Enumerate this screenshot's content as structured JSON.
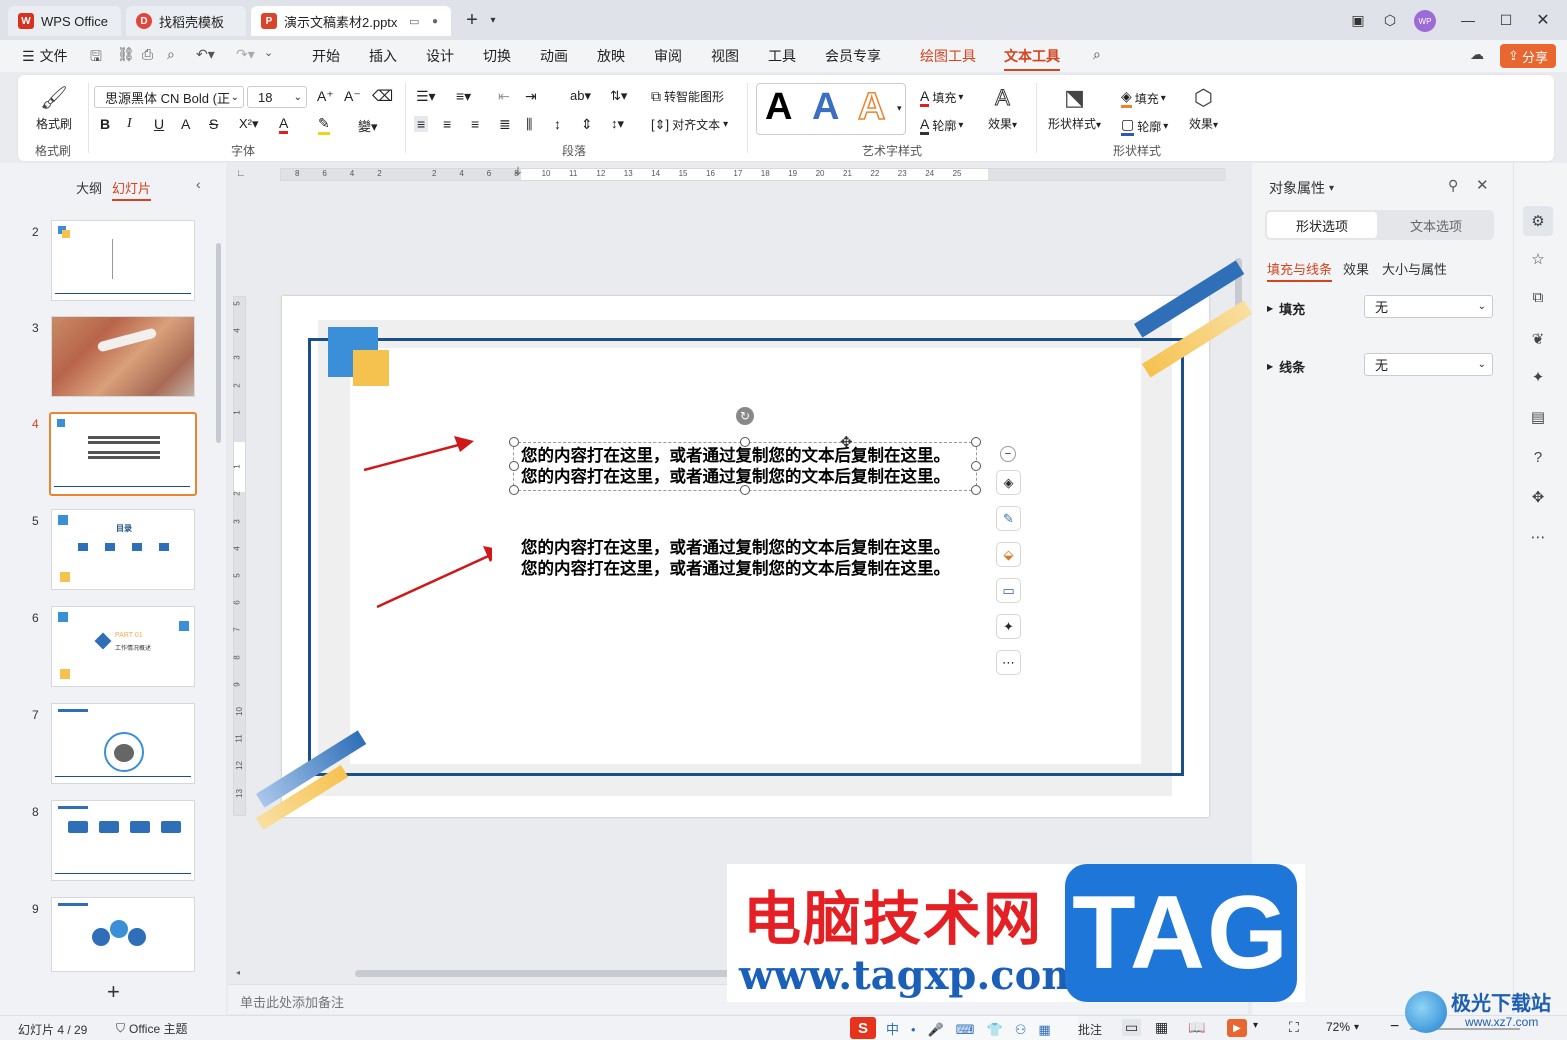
{
  "titlebar": {
    "tabs": [
      {
        "label": "WPS Office",
        "logo": "W"
      },
      {
        "label": "找稻壳模板",
        "logo": "D"
      },
      {
        "label": "演示文稿素材2.pptx",
        "logo": "P"
      }
    ],
    "avatar": "WP"
  },
  "menubar": {
    "file": "文件",
    "items": [
      "开始",
      "插入",
      "设计",
      "切换",
      "动画",
      "放映",
      "审阅",
      "视图",
      "工具",
      "会员专享"
    ],
    "context_tabs": [
      "绘图工具",
      "文本工具"
    ],
    "share": "分享"
  },
  "ribbon": {
    "format_painter": "格式刷",
    "font_name": "思源黑体 CN Bold (正",
    "font_size": "18",
    "smart_shape": "转智能图形",
    "align_text": "对齐文本",
    "fill": "填充",
    "outline": "轮廓",
    "effect": "效果",
    "shape_style": "形状样式",
    "shape_fill": "填充",
    "shape_outline": "轮廓",
    "shape_effect": "效果",
    "groups": [
      "格式刷",
      "字体",
      "段落",
      "艺术字样式",
      "形状样式"
    ],
    "art_letters": [
      "A",
      "A",
      "A"
    ]
  },
  "leftpane": {
    "tab_outline": "大纲",
    "tab_slides": "幻灯片",
    "slides": [
      {
        "num": "2"
      },
      {
        "num": "3"
      },
      {
        "num": "4"
      },
      {
        "num": "5"
      },
      {
        "num": "6"
      },
      {
        "num": "7"
      },
      {
        "num": "8"
      },
      {
        "num": "9"
      }
    ],
    "slide5_title": "目录",
    "slide6_part": "PART 01",
    "slide6_sub": "工作情况概述",
    "add": "+"
  },
  "slide": {
    "lines": [
      "您的内容打在这里，或者通过复制您的文本后复制在这里。",
      "您的内容打在这里，或者通过复制您的文本后复制在这里。",
      "您的内容打在这里，或者通过复制您的文本后复制在这里。",
      "您的内容打在这里，或者通过复制您的文本后复制在这里。"
    ],
    "notes_placeholder": "单击此处添加备注"
  },
  "ruler": {
    "h_ticks": [
      "8",
      "6",
      "4",
      "2",
      "",
      "2",
      "4",
      "6",
      "8",
      "10",
      "11",
      "12",
      "13",
      "14",
      "15",
      "16",
      "17",
      "18",
      "19",
      "20",
      "21",
      "22",
      "23",
      "24",
      "25"
    ],
    "v_ticks": [
      "5",
      "4",
      "3",
      "2",
      "1",
      "",
      "1",
      "2",
      "3",
      "4",
      "5",
      "6",
      "7",
      "8",
      "9",
      "10",
      "11",
      "12",
      "13"
    ]
  },
  "rightpane": {
    "title": "对象属性",
    "tab_shape": "形状选项",
    "tab_text": "文本选项",
    "subtabs": [
      "填充与线条",
      "效果",
      "大小与属性"
    ],
    "fill_label": "填充",
    "fill_value": "无",
    "line_label": "线条",
    "line_value": "无"
  },
  "statusbar": {
    "slide_info": "幻灯片 4 / 29",
    "theme": "Office 主题",
    "notes": "批注",
    "zoom": "72%"
  },
  "watermark": {
    "title": "电脑技术网",
    "url": "www.tagxp.com",
    "tag": "TAG",
    "corner": "极光下载站",
    "corner_url": "www.xz7.com"
  },
  "colors": {
    "accent": "#d6431e",
    "slide_blue": "#1a4f8a",
    "slide_yellow": "#f6c24f",
    "light_blue": "#3a8fd8"
  }
}
